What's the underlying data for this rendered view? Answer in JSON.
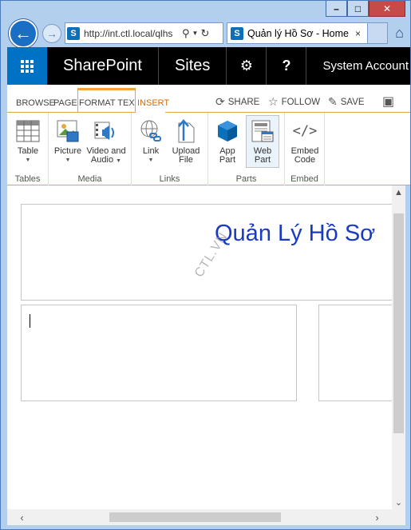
{
  "window": {
    "controls": {
      "minimize": "–",
      "maximize": "□",
      "close": "✕"
    }
  },
  "browser": {
    "address": "http://int.ctl.local/qlhs",
    "tab_title": "Quản lý Hồ Sơ - Home",
    "tab_close": "×",
    "icons": {
      "back": "back-arrow-icon",
      "forward": "forward-arrow-icon",
      "search": "search-icon",
      "refresh": "refresh-icon",
      "home": "home-icon"
    }
  },
  "suitebar": {
    "brand": "SharePoint",
    "sites": "Sites",
    "settings_glyph": "⚙",
    "help_glyph": "?",
    "user": "System Account"
  },
  "ribbon_tabs": {
    "browse": "BROWSE",
    "page": "PAGE",
    "format_text": "FORMAT TEXT",
    "insert": "INSERT",
    "share": "SHARE",
    "follow": "FOLLOW",
    "save": "SAVE"
  },
  "ribbon": {
    "groups": [
      {
        "label": "Tables",
        "buttons": [
          {
            "label": "Table",
            "dropdown": true
          }
        ]
      },
      {
        "label": "Media",
        "buttons": [
          {
            "label": "Picture",
            "dropdown": true
          },
          {
            "label": "Video and Audio",
            "dropdown": true
          }
        ]
      },
      {
        "label": "Links",
        "buttons": [
          {
            "label": "Link",
            "dropdown": true
          },
          {
            "label": "Upload File",
            "dropdown": false
          }
        ]
      },
      {
        "label": "Parts",
        "buttons": [
          {
            "label": "App Part",
            "dropdown": false
          },
          {
            "label": "Web Part",
            "dropdown": false
          }
        ]
      },
      {
        "label": "Embed",
        "buttons": [
          {
            "label": "Embed Code",
            "dropdown": false
          }
        ]
      }
    ],
    "labels": {
      "table1": "Table",
      "picture1": "Picture",
      "video1": "Video and",
      "video2": "Audio",
      "link1": "Link",
      "upload1": "Upload",
      "upload2": "File",
      "app1": "App",
      "app2": "Part",
      "web1": "Web",
      "web2": "Part",
      "embed1": "Embed",
      "embed2": "Code"
    }
  },
  "content": {
    "page_title": "Quản Lý Hồ Sơ",
    "watermark": "CTL.VN"
  },
  "colors": {
    "accent": "#0072c6",
    "ribbon_orange": "#e5a04d",
    "title_blue": "#1a3bc1"
  }
}
